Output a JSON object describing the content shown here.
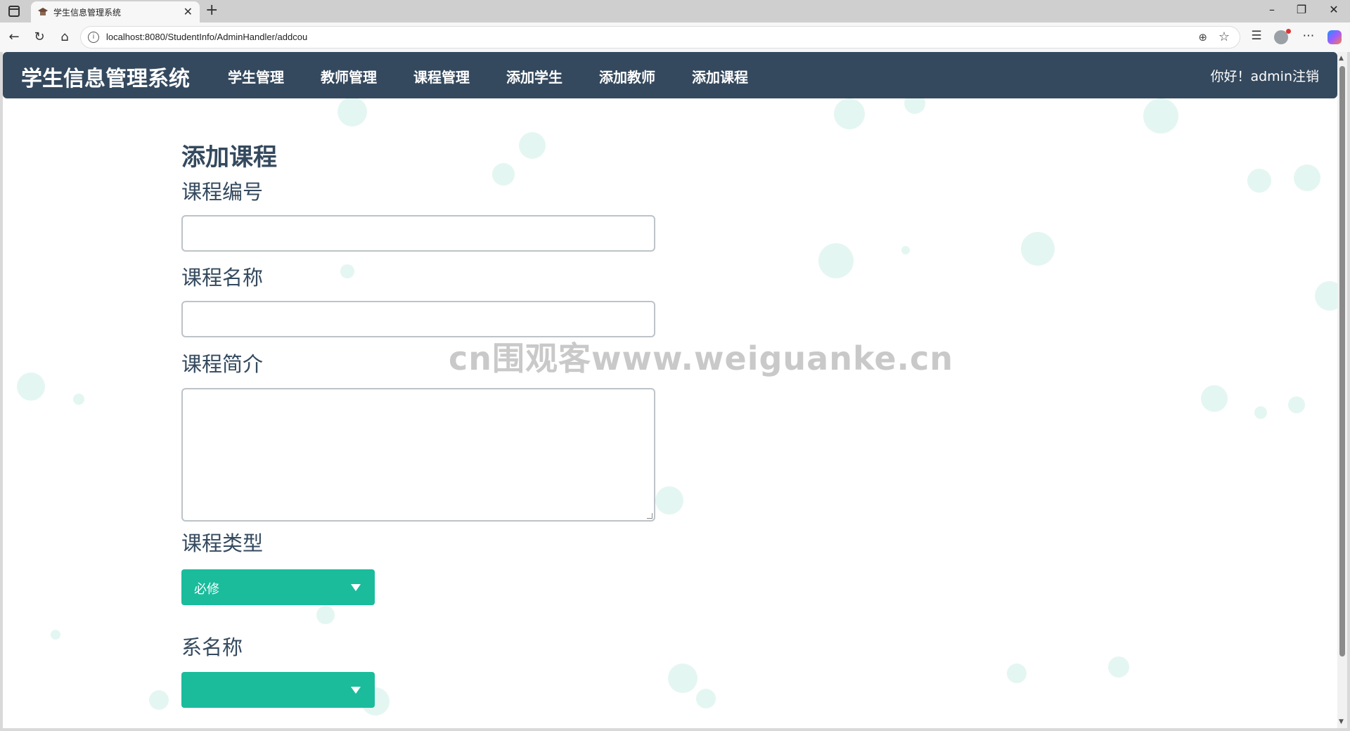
{
  "browser": {
    "tab_title": "学生信息管理系统",
    "tab_close": "✕",
    "new_tab": "+",
    "url": "localhost:8080/StudentInfo/AdminHandler/addcou",
    "icons": [
      "back-icon",
      "reload-icon",
      "home-icon",
      "info-icon",
      "zoom-icon",
      "favorite-star-icon",
      "favorites-icon",
      "profile-icon",
      "more-icon",
      "copilot-icon"
    ]
  },
  "navbar": {
    "brand": "学生信息管理系统",
    "items": [
      "学生管理",
      "教师管理",
      "课程管理",
      "添加学生",
      "添加教师",
      "添加课程"
    ],
    "greeting": "你好！admin注销"
  },
  "form": {
    "heading": "添加课程",
    "course_id_label": "课程编号",
    "course_id_value": "",
    "course_name_label": "课程名称",
    "course_name_value": "",
    "course_intro_label": "课程简介",
    "course_intro_value": "",
    "course_type_label": "课程类型",
    "course_type_selected": "必修",
    "dept_label": "系名称",
    "dept_selected": ""
  },
  "watermark": "cn围观客www.weiguanke.cn",
  "colors": {
    "navbar_bg": "#34495e",
    "select_bg": "#1abc9c",
    "label_text": "#34495e"
  }
}
